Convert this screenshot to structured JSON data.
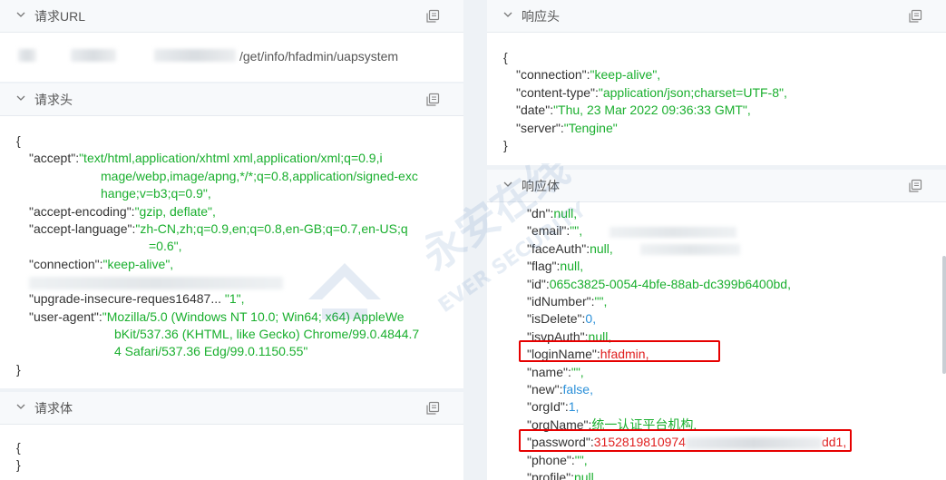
{
  "request_url": {
    "title": "请求URL",
    "url_visible": "/get/info/hfadmin/uapsystem"
  },
  "request_headers": {
    "title": "请求头",
    "open_brace": "{",
    "close_brace": "}",
    "accept_key": "\"accept\":",
    "accept_val_1": "\"text/html,application/xhtml xml,application/xml;q=0.9,i",
    "accept_val_2": "mage/webp,image/apng,*/*;q=0.8,application/signed-exc",
    "accept_val_3": "hange;v=b3;q=0.9\",",
    "encoding_key": "\"accept-encoding\":",
    "encoding_val": "\"gzip, deflate\",",
    "language_key": "\"accept-language\":",
    "language_val_1": "\"zh-CN,zh;q=0.9,en;q=0.8,en-GB;q=0.7,en-US;q",
    "language_val_2": "=0.6\",",
    "connection_key": "\"connection\":",
    "connection_val": "\"keep-alive\",",
    "upgrade_key": "\"upgrade-insecure-reques16487...",
    "upgrade_val": "\"1\",",
    "ua_key": "\"user-agent\":",
    "ua_val_1": "\"Mozilla/5.0 (Windows NT 10.0; Win64; x64) AppleWe",
    "ua_val_2": "bKit/537.36 (KHTML, like Gecko) Chrome/99.0.4844.7",
    "ua_val_3": "4 Safari/537.36 Edg/99.0.1150.55\""
  },
  "request_body": {
    "title": "请求体",
    "open_brace": "{",
    "close_brace": "}"
  },
  "response_headers": {
    "title": "响应头",
    "open_brace": "{",
    "close_brace": "}",
    "rows": [
      {
        "key": "\"connection\":",
        "val": "\"keep-alive\","
      },
      {
        "key": "\"content-type\":",
        "val": "\"application/json;charset=UTF-8\","
      },
      {
        "key": "\"date\":",
        "val": "\"Thu, 23 Mar 2022 09:36:33 GMT\","
      },
      {
        "key": "\"server\":",
        "val": "\"Tengine\""
      }
    ]
  },
  "response_body": {
    "title": "响应体",
    "dn_key": "\"dn\":",
    "dn_val": "null,",
    "email_key": "\"email\":",
    "email_val": "\"\",",
    "faceauth_key": "\"faceAuth\":",
    "faceauth_val": "null,",
    "flag_key": "\"flag\":",
    "flag_val": "null,",
    "id_key": "\"id\":",
    "id_val": "065c3825-0054-4bfe-88ab-dc399b6400bd,",
    "idnumber_key": "\"idNumber\":",
    "idnumber_val": "\"\",",
    "isdelete_key": "\"isDelete\":",
    "isdelete_val": "0,",
    "isvpauth_key": "\"isvpAuth\":",
    "isvpauth_val": "null,",
    "loginname_key": "\"loginName\":",
    "loginname_val": "hfadmin,",
    "name_key": "\"name\":",
    "name_val": "\"\",",
    "new_key": "\"new\":",
    "new_val": "false,",
    "orgid_key": "\"orgId\":",
    "orgid_val": "1,",
    "orgname_key": "\"orgName\":",
    "orgname_val": "统一认证平台机构,",
    "password_key": "\"password\":",
    "password_val_start": "3152819810974",
    "password_val_end": "dd1,",
    "phone_key": "\"phone\":",
    "phone_val": "\"\",",
    "profile_key": "\"profile\":",
    "profile_val": "null,"
  },
  "watermark": {
    "text_cn": "永安在线",
    "text_en": "EVER SECURITY"
  },
  "colors": {
    "string": "#1aaf2e",
    "number": "#2b90d9",
    "highlight": "#e60000"
  }
}
